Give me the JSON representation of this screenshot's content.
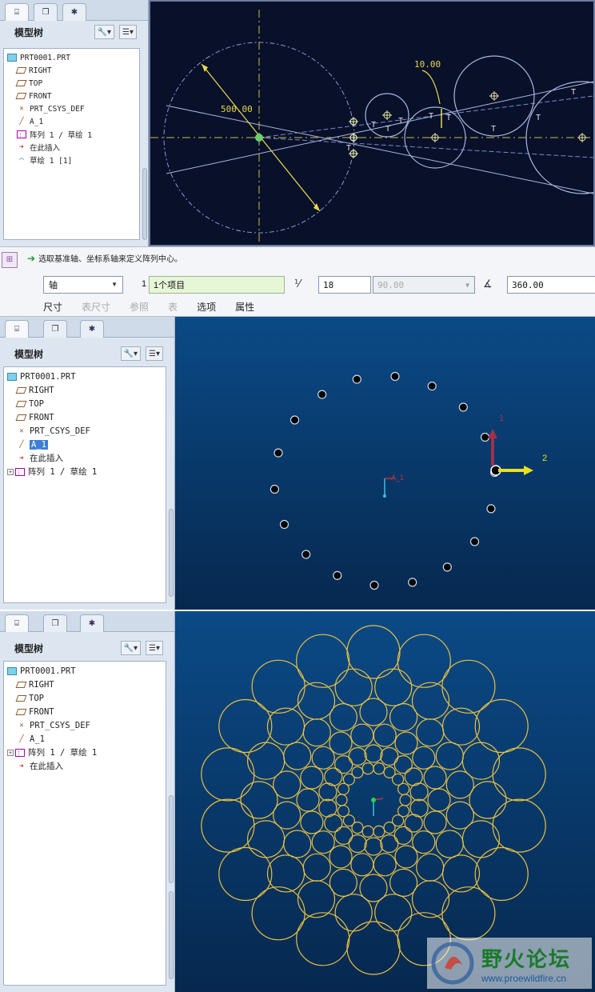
{
  "tree_panel": {
    "title": "模型树",
    "tabs": [
      "model-tree",
      "layers",
      "favorites"
    ]
  },
  "panel1": {
    "tree": [
      {
        "label": "PRT0001.PRT",
        "icon": "part-icon"
      },
      {
        "label": "RIGHT",
        "icon": "datum-plane-icon"
      },
      {
        "label": "TOP",
        "icon": "datum-plane-icon"
      },
      {
        "label": "FRONT",
        "icon": "datum-plane-icon"
      },
      {
        "label": "PRT_CSYS_DEF",
        "icon": "csys-icon"
      },
      {
        "label": "A_1",
        "icon": "datum-axis-icon"
      },
      {
        "label": "阵列 1 / 草绘 1",
        "icon": "pattern-icon"
      },
      {
        "label": "在此插入",
        "icon": "insert-here-icon"
      },
      {
        "label": "草绘 1 [1]",
        "icon": "sketch-icon"
      }
    ],
    "dims": {
      "diameter": "500.00",
      "small": "10.00"
    },
    "constraint_label": "T"
  },
  "dashboard": {
    "message": "选取基准轴、坐标系轴来定义阵列中心。",
    "type_select": "轴",
    "count_label": "1",
    "collector": "1个项目",
    "member_count": "18",
    "angle_increment": "90.00",
    "total_angle": "360.00",
    "tabs": [
      {
        "label": "尺寸",
        "enabled": true
      },
      {
        "label": "表尺寸",
        "enabled": false
      },
      {
        "label": "参照",
        "enabled": false
      },
      {
        "label": "表",
        "enabled": false
      },
      {
        "label": "选项",
        "enabled": true
      },
      {
        "label": "属性",
        "enabled": true
      }
    ]
  },
  "panel2": {
    "tree": [
      {
        "label": "PRT0001.PRT",
        "icon": "part-icon"
      },
      {
        "label": "RIGHT",
        "icon": "datum-plane-icon"
      },
      {
        "label": "TOP",
        "icon": "datum-plane-icon"
      },
      {
        "label": "FRONT",
        "icon": "datum-plane-icon"
      },
      {
        "label": "PRT_CSYS_DEF",
        "icon": "csys-icon"
      },
      {
        "label": "A_1",
        "icon": "datum-axis-icon",
        "selected": true
      },
      {
        "label": "在此插入",
        "icon": "insert-here-icon"
      },
      {
        "label": "阵列 1 / 草绘 1",
        "icon": "pattern-icon",
        "expandable": true
      }
    ],
    "axis_label_1": "1",
    "axis_label_2": "2",
    "csys_label": "A_1",
    "dot_count": 18
  },
  "panel3": {
    "tree": [
      {
        "label": "PRT0001.PRT",
        "icon": "part-icon"
      },
      {
        "label": "RIGHT",
        "icon": "datum-plane-icon"
      },
      {
        "label": "TOP",
        "icon": "datum-plane-icon"
      },
      {
        "label": "FRONT",
        "icon": "datum-plane-icon"
      },
      {
        "label": "PRT_CSYS_DEF",
        "icon": "csys-icon"
      },
      {
        "label": "A_1",
        "icon": "datum-axis-icon"
      },
      {
        "label": "阵列 1 / 草绘 1",
        "icon": "pattern-icon",
        "expandable": true
      },
      {
        "label": "在此插入",
        "icon": "insert-here-icon"
      }
    ],
    "circle_color": "#e8c040"
  },
  "watermark": {
    "name": "野火论坛",
    "url": "www.proewildfire.cn"
  },
  "colors": {
    "sketch_bg": "#08102a",
    "model_bg": "#0b4a86",
    "dim_yellow": "#e8d84a",
    "sketch_line": "#a8b8e0"
  }
}
